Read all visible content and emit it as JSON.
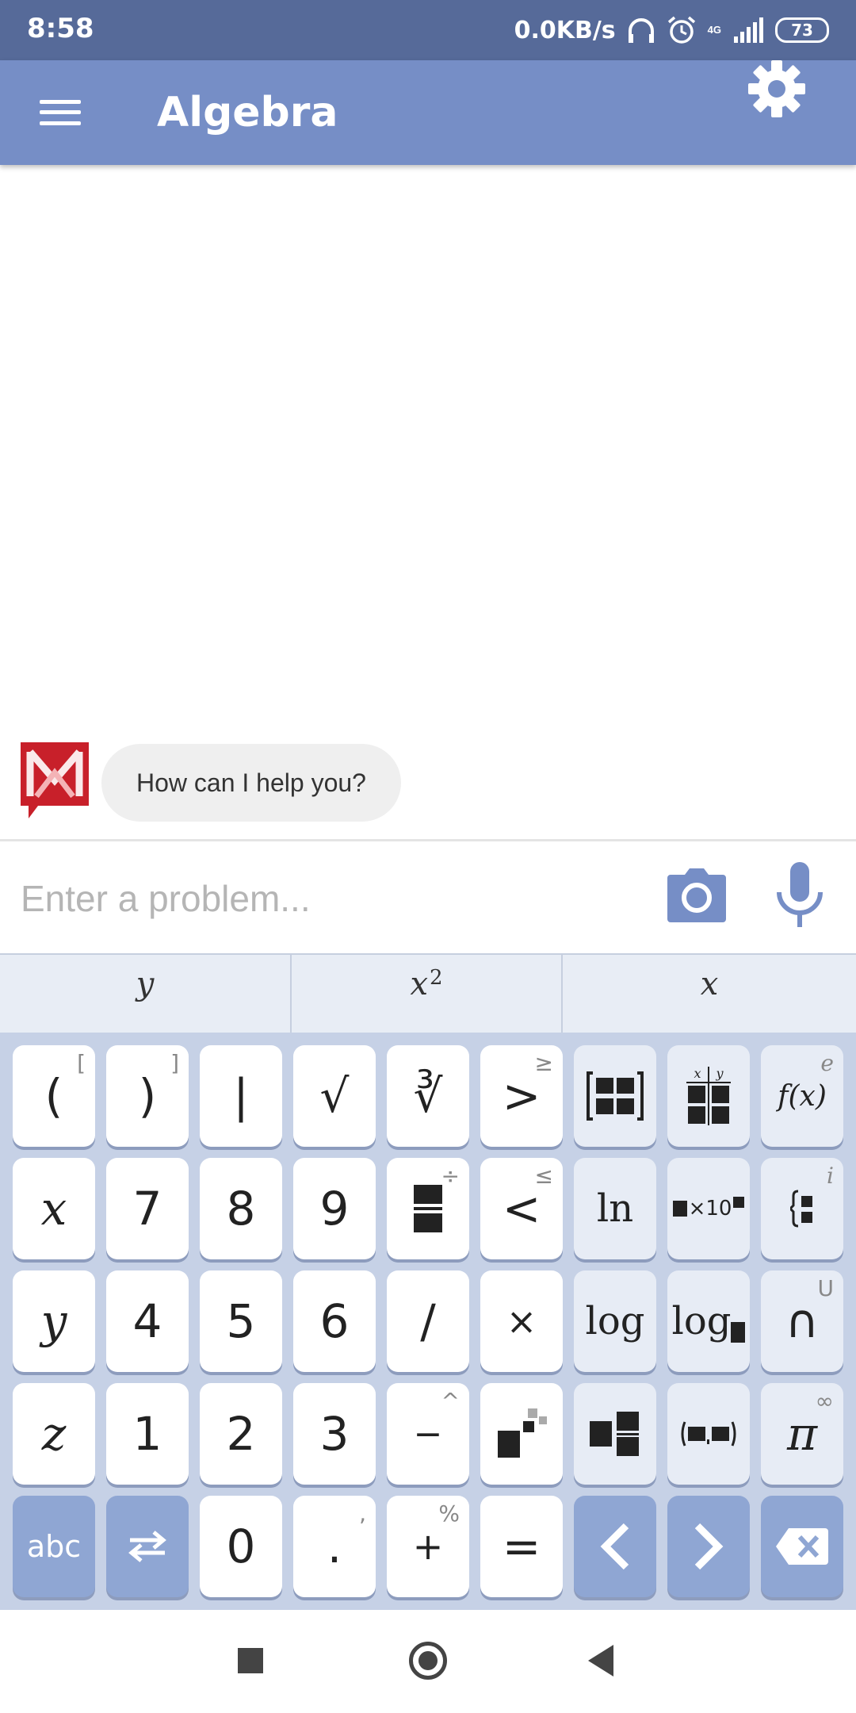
{
  "status_bar": {
    "time": "8:58",
    "net_speed": "0.0KB/s",
    "network": "4G",
    "battery": "73"
  },
  "app_bar": {
    "title": "Algebra",
    "menu_icon": "menu-icon",
    "settings_icon": "gear-icon"
  },
  "chat": {
    "assistant_message": "How can I help you?"
  },
  "input": {
    "placeholder": "Enter a problem...",
    "value": ""
  },
  "suggestions": [
    "y",
    "x",
    "x"
  ],
  "suggestion_superscripts": [
    "",
    "2",
    ""
  ],
  "keyboard": {
    "row1": {
      "open_paren": "(",
      "open_paren_alt": "[",
      "close_paren": ")",
      "close_paren_alt": "]",
      "abs": "|",
      "sqrt": "√",
      "nth_root": "∛",
      "gt": ">",
      "gt_alt": "≥",
      "fx": "f(x)",
      "fx_alt": "e"
    },
    "row2": {
      "x": "x",
      "seven": "7",
      "eight": "8",
      "nine": "9",
      "frac_alt": "÷",
      "lt": "<",
      "lt_alt": "≤",
      "ln": "ln",
      "sci_times": "×10",
      "piecewise_alt": "i"
    },
    "row3": {
      "y": "y",
      "four": "4",
      "five": "5",
      "six": "6",
      "divide": "/",
      "times": "×",
      "log": "log",
      "log_base": "log",
      "intersect": "∩",
      "intersect_alt": "U"
    },
    "row4": {
      "z": "z",
      "one": "1",
      "two": "2",
      "three": "3",
      "minus": "−",
      "minus_alt": "^",
      "pi": "π",
      "pi_alt": "∞"
    },
    "row5": {
      "abc": "abc",
      "zero": "0",
      "dot": ".",
      "dot_alt": ",",
      "plus": "+",
      "plus_alt": "%",
      "equals": "="
    }
  },
  "colors": {
    "status_bar": "#566a99",
    "app_bar": "#768ec6",
    "keyboard_bg": "#c6d1e6",
    "dark_key": "#8fa6d3",
    "accent_icon": "#768ec6",
    "logo_red": "#c8202a"
  }
}
